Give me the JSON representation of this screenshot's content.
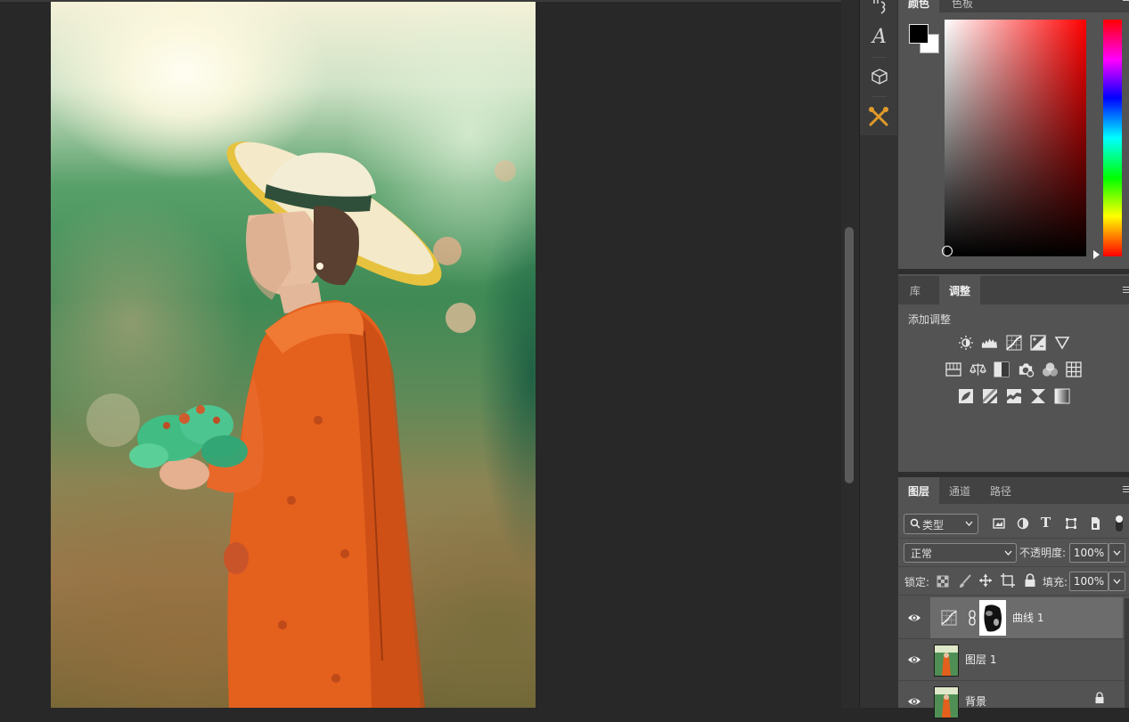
{
  "color_panel": {
    "tabs": [
      "颜色",
      "色板"
    ],
    "foreground": "#000000",
    "background": "#ffffff",
    "hue": "#ff0000"
  },
  "adjustments_panel": {
    "tabs": [
      "库",
      "调整"
    ],
    "active_tab": "调整",
    "heading": "添加调整",
    "rows": [
      [
        "brightness-contrast-icon",
        "levels-icon",
        "curves-icon",
        "exposure-icon",
        "vibrance-icon"
      ],
      [
        "hue-saturation-icon",
        "color-balance-icon",
        "black-white-icon",
        "photo-filter-icon",
        "channel-mixer-icon",
        "color-lookup-icon"
      ],
      [
        "invert-icon",
        "posterize-icon",
        "threshold-icon",
        "selective-color-icon",
        "gradient-map-icon"
      ]
    ]
  },
  "layers_panel": {
    "tabs": [
      "图层",
      "通道",
      "路径"
    ],
    "active_tab": "图层",
    "filter_label": "类型",
    "blend_mode": "正常",
    "opacity_label": "不透明度:",
    "opacity_value": "100%",
    "lock_label": "锁定:",
    "fill_label": "填充:",
    "fill_value": "100%",
    "layers": [
      {
        "name": "曲线 1",
        "type": "adjustment-curves",
        "visible": true,
        "selected": true
      },
      {
        "name": "图层 1",
        "type": "pixel",
        "visible": true,
        "selected": false
      },
      {
        "name": "背景",
        "type": "background",
        "visible": true,
        "selected": false,
        "locked": true
      }
    ]
  },
  "tools": [
    "paragraph-tool-icon",
    "character-tool-icon",
    "3d-tool-icon",
    "tools-extension-icon"
  ],
  "colors": {
    "panel_bg": "#535353",
    "tab_bg": "#424242",
    "canvas_bg": "#282828",
    "selected_layer": "#6c6c6c",
    "accent_orange": "#e09a2a"
  }
}
